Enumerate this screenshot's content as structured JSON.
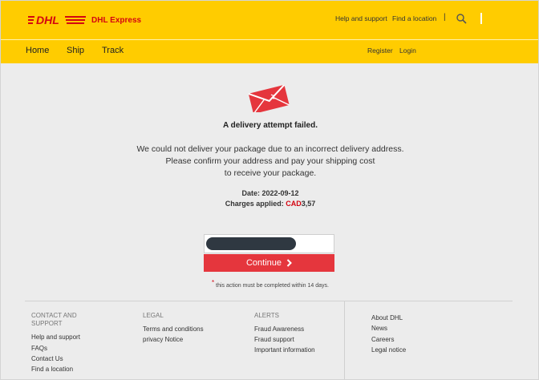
{
  "header": {
    "brand_name": "DHL Express",
    "utility_links": [
      "Help and support",
      "Find a location"
    ],
    "separator": "|"
  },
  "nav": {
    "items": [
      "Home",
      "Ship",
      "Track"
    ],
    "account": {
      "register": "Register",
      "login": "Login"
    }
  },
  "main": {
    "headline": "A delivery attempt failed.",
    "message_lines": [
      "We could not deliver your package due to an incorrect delivery address.",
      "Please confirm your address and pay your shipping cost",
      "to receive your package."
    ],
    "date_label": "Date:",
    "date_value": "2022-09-12",
    "charges_label": "Charges applied:",
    "charges_currency": "CAD",
    "charges_amount": "3,57",
    "continue_label": "Continue",
    "note_marker": "*",
    "note_text": "this action must be completed within 14 days."
  },
  "footer": {
    "columns": [
      {
        "heading": "CONTACT AND SUPPORT",
        "links": [
          "Help and support",
          "FAQs",
          "Contact Us",
          "Find a location"
        ]
      },
      {
        "heading": "LEGAL",
        "links": [
          "Terms and conditions",
          "privacy Notice"
        ]
      },
      {
        "heading": "ALERTS",
        "links": [
          "Fraud Awareness",
          "Fraud support",
          "Important information"
        ]
      },
      {
        "heading": "",
        "links": [
          "About DHL",
          "News",
          "Careers",
          "Legal notice"
        ]
      }
    ]
  },
  "colors": {
    "dhl_yellow": "#ffcc00",
    "dhl_red": "#d40511",
    "button_red": "#e5363d"
  },
  "icons": [
    "dhl-logo",
    "search-icon",
    "envelope-icon",
    "chevron-right-icon"
  ]
}
